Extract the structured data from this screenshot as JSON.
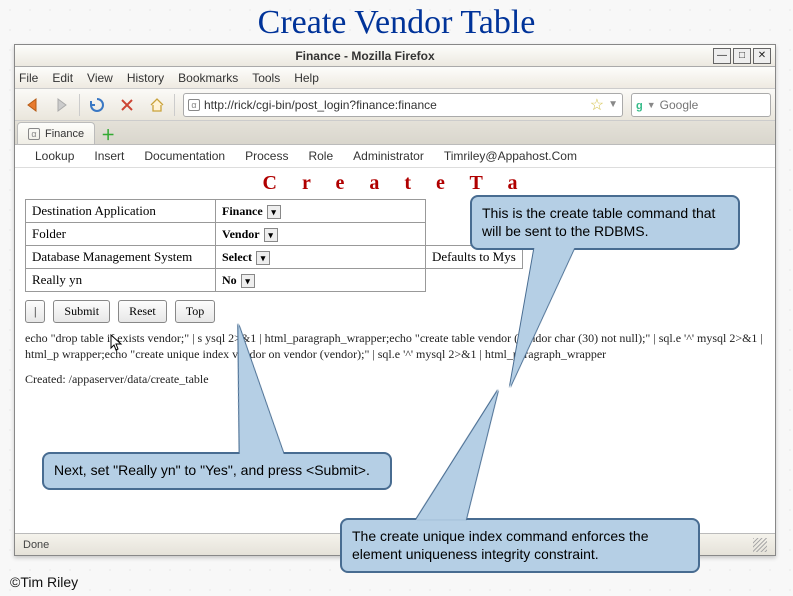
{
  "slide": {
    "title": "Create Vendor Table",
    "copyright": "©Tim Riley"
  },
  "window": {
    "title": "Finance - Mozilla Firefox",
    "menus": [
      "File",
      "Edit",
      "View",
      "History",
      "Bookmarks",
      "Tools",
      "Help"
    ],
    "url": "http://rick/cgi-bin/post_login?finance:finance",
    "search_placeholder": "Google",
    "tab_label": "Finance",
    "status": "Done"
  },
  "app": {
    "nav": [
      "Lookup",
      "Insert",
      "Documentation",
      "Process",
      "Role",
      "Administrator",
      "Timriley@Appahost.Com"
    ],
    "page_title": "C r e a t e   T a",
    "form": {
      "rows": [
        {
          "label": "Destination Application",
          "value": "Finance",
          "hint": ""
        },
        {
          "label": "Folder",
          "value": "Vendor",
          "hint": ""
        },
        {
          "label": "Database Management System",
          "value": "Select",
          "hint": "Defaults to Mys"
        },
        {
          "label": "Really yn",
          "value": "No",
          "hint": ""
        }
      ]
    },
    "buttons": {
      "pipe": "|",
      "submit": "Submit",
      "reset": "Reset",
      "top": "Top"
    },
    "console_line1": "echo \"drop table if exists vendor;\" | s               ysql 2>&1 | html_paragraph_wrapper;echo \"create table vendor (vendor char (30) not null);\" | sql.e '^' mysql 2>&1 | html_p             wrapper;echo \"create unique index vendor on vendor (vendor);\" | sql.e '^' mysql 2>&1 | html_paragraph_wrapper",
    "console_line2": "Created: /appaserver/data/create_table"
  },
  "callouts": {
    "c1": "This is the create table command that will be sent to the RDBMS.",
    "c2": "Next, set \"Really yn\" to \"Yes\", and press <Submit>.",
    "c3": "The create unique index command enforces the element uniqueness integrity constraint."
  }
}
